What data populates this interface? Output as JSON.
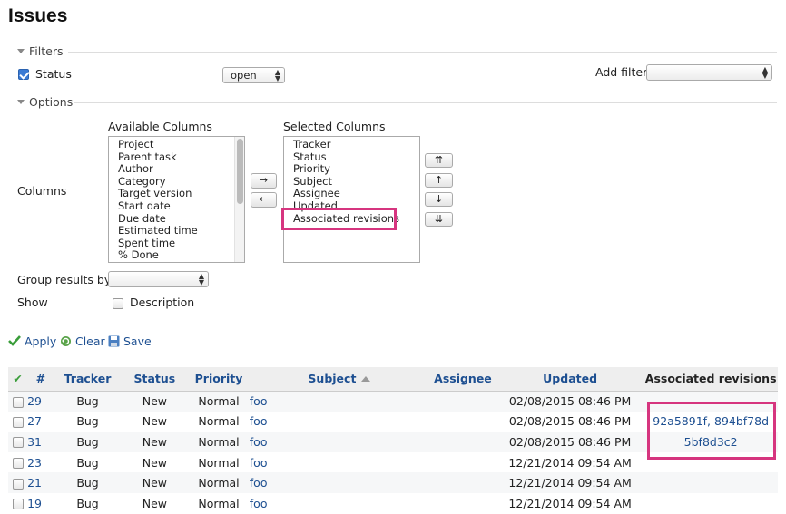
{
  "page_title": "Issues",
  "filters": {
    "legend": "Filters",
    "status_label": "Status",
    "status_value": "open",
    "add_filter_label": "Add filter"
  },
  "options": {
    "legend": "Options",
    "columns_label": "Columns",
    "available_title": "Available Columns",
    "available": [
      "Project",
      "Parent task",
      "Author",
      "Category",
      "Target version",
      "Start date",
      "Due date",
      "Estimated time",
      "Spent time",
      "% Done"
    ],
    "selected_title": "Selected Columns",
    "selected": [
      "Tracker",
      "Status",
      "Priority",
      "Subject",
      "Assignee",
      "Updated",
      "Associated revisions"
    ],
    "move_right": "→",
    "move_left": "←",
    "move_top": "⇈",
    "move_up": "↑",
    "move_down": "↓",
    "move_bottom": "⇊",
    "group_by_label": "Group results by",
    "show_label": "Show",
    "description_label": "Description"
  },
  "actions": {
    "apply": "Apply",
    "clear": "Clear",
    "save": "Save"
  },
  "table": {
    "headers": {
      "num": "#",
      "tracker": "Tracker",
      "status": "Status",
      "priority": "Priority",
      "subject": "Subject",
      "assignee": "Assignee",
      "updated": "Updated",
      "revisions": "Associated revisions"
    },
    "rows": [
      {
        "id": "29",
        "tracker": "Bug",
        "status": "New",
        "priority": "Normal",
        "subject": "foo",
        "assignee": "",
        "updated": "02/08/2015 08:46 PM",
        "rev": ""
      },
      {
        "id": "27",
        "tracker": "Bug",
        "status": "New",
        "priority": "Normal",
        "subject": "foo",
        "assignee": "",
        "updated": "02/08/2015 08:46 PM",
        "rev": "92a5891f, 894bf78d"
      },
      {
        "id": "31",
        "tracker": "Bug",
        "status": "New",
        "priority": "Normal",
        "subject": "foo",
        "assignee": "",
        "updated": "02/08/2015 08:46 PM",
        "rev": "5bf8d3c2"
      },
      {
        "id": "23",
        "tracker": "Bug",
        "status": "New",
        "priority": "Normal",
        "subject": "foo",
        "assignee": "",
        "updated": "12/21/2014 09:54 AM",
        "rev": ""
      },
      {
        "id": "21",
        "tracker": "Bug",
        "status": "New",
        "priority": "Normal",
        "subject": "foo",
        "assignee": "",
        "updated": "12/21/2014 09:54 AM",
        "rev": ""
      },
      {
        "id": "19",
        "tracker": "Bug",
        "status": "New",
        "priority": "Normal",
        "subject": "foo",
        "assignee": "",
        "updated": "12/21/2014 09:54 AM",
        "rev": ""
      }
    ]
  },
  "colors": {
    "link": "#1d4f91",
    "highlight": "#d6357f",
    "checkbox_checked": "#3b7bd4"
  },
  "icons": {
    "apply": "green-check-icon",
    "clear": "refresh-icon",
    "save": "floppy-disk-icon"
  }
}
